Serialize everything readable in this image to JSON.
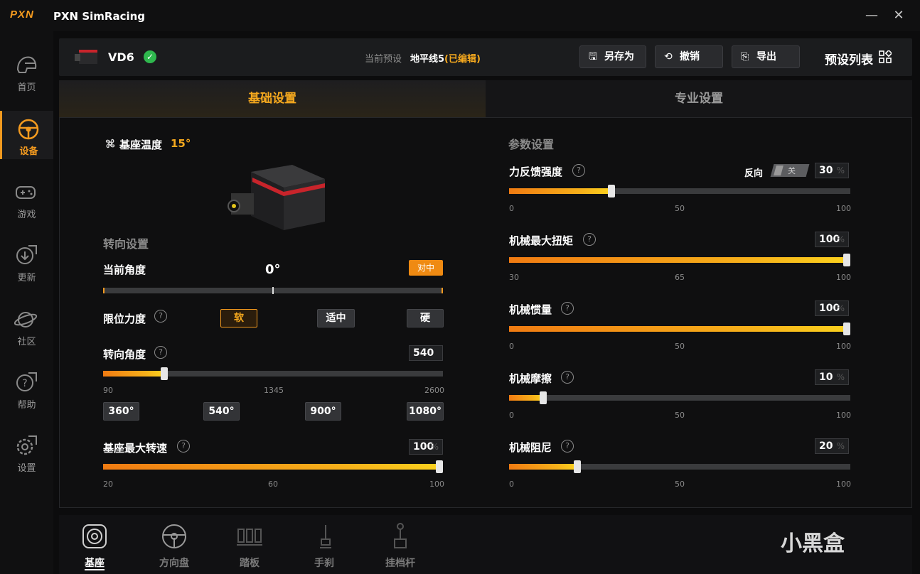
{
  "app": {
    "logo_text": "PXN",
    "title": "PXN SimRacing",
    "minimize_glyph": "—",
    "close_glyph": "✕"
  },
  "sidebar": {
    "items": [
      {
        "label": "首页",
        "icon": "helmet-icon"
      },
      {
        "label": "设备",
        "icon": "steering-wheel-icon",
        "active": true
      },
      {
        "label": "游戏",
        "icon": "gamepad-icon"
      },
      {
        "label": "更新",
        "icon": "download-icon"
      },
      {
        "label": "社区",
        "icon": "planet-icon"
      },
      {
        "label": "帮助",
        "icon": "help-icon"
      },
      {
        "label": "设置",
        "icon": "gear-icon"
      }
    ]
  },
  "topbar": {
    "device_name": "VD6",
    "device_status_glyph": "✓",
    "preset_label": "当前预设",
    "preset_name": "地平线5",
    "preset_state": "(已编辑)",
    "save_as": "另存为",
    "undo": "撤销",
    "export": "导出",
    "preset_list": "预设列表"
  },
  "tabs": [
    {
      "label": "基础设置",
      "active": true
    },
    {
      "label": "专业设置",
      "active": false
    }
  ],
  "left": {
    "base_temp_label": "基座温度",
    "base_temp_value": "15°",
    "steering_section": "转向设置",
    "current_angle_label": "当前角度",
    "current_angle_value": "0°",
    "center_button": "对中",
    "limit_force_label": "限位力度",
    "limit_force_options": [
      "软",
      "适中",
      "硬"
    ],
    "limit_force_selected": "软",
    "steering_angle_label": "转向角度",
    "steering_angle_value": "540",
    "steering_angle_ticks": [
      "90",
      "1345",
      "2600"
    ],
    "steering_angle_min": 90,
    "steering_angle_max": 2600,
    "steering_angle_presets": [
      "360°",
      "540°",
      "900°",
      "1080°"
    ],
    "max_speed_label": "基座最大转速",
    "max_speed_value": "100",
    "max_speed_unit": "%",
    "max_speed_ticks": [
      "20",
      "60",
      "100"
    ],
    "max_speed_min": 20,
    "max_speed_max": 100
  },
  "right": {
    "param_section": "参数设置",
    "reverse_label": "反向",
    "reverse_toggle": "关",
    "sliders": [
      {
        "label": "力反馈强度",
        "value": "30",
        "unit": "%",
        "ticks": [
          "0",
          "50",
          "100"
        ],
        "min": 0,
        "max": 100
      },
      {
        "label": "机械最大扭矩",
        "value": "100",
        "unit": "%",
        "ticks": [
          "30",
          "65",
          "100"
        ],
        "min": 30,
        "max": 100
      },
      {
        "label": "机械惯量",
        "value": "100",
        "unit": "%",
        "ticks": [
          "0",
          "50",
          "100"
        ],
        "min": 0,
        "max": 100
      },
      {
        "label": "机械摩擦",
        "value": "10",
        "unit": "%",
        "ticks": [
          "0",
          "50",
          "100"
        ],
        "min": 0,
        "max": 100
      },
      {
        "label": "机械阻尼",
        "value": "20",
        "unit": "%",
        "ticks": [
          "0",
          "50",
          "100"
        ],
        "min": 0,
        "max": 100
      }
    ]
  },
  "bottom_nav": [
    {
      "label": "基座",
      "icon": "wheelbase-icon",
      "active": true
    },
    {
      "label": "方向盘",
      "icon": "steering-wheel-icon",
      "active": false
    },
    {
      "label": "踏板",
      "icon": "pedals-icon",
      "active": false
    },
    {
      "label": "手刹",
      "icon": "handbrake-icon",
      "active": false
    },
    {
      "label": "挂档杆",
      "icon": "shifter-icon",
      "active": false
    }
  ],
  "watermark": "小黑盒",
  "colors": {
    "accent": "#f39a1f",
    "ok": "#2fb84e"
  }
}
